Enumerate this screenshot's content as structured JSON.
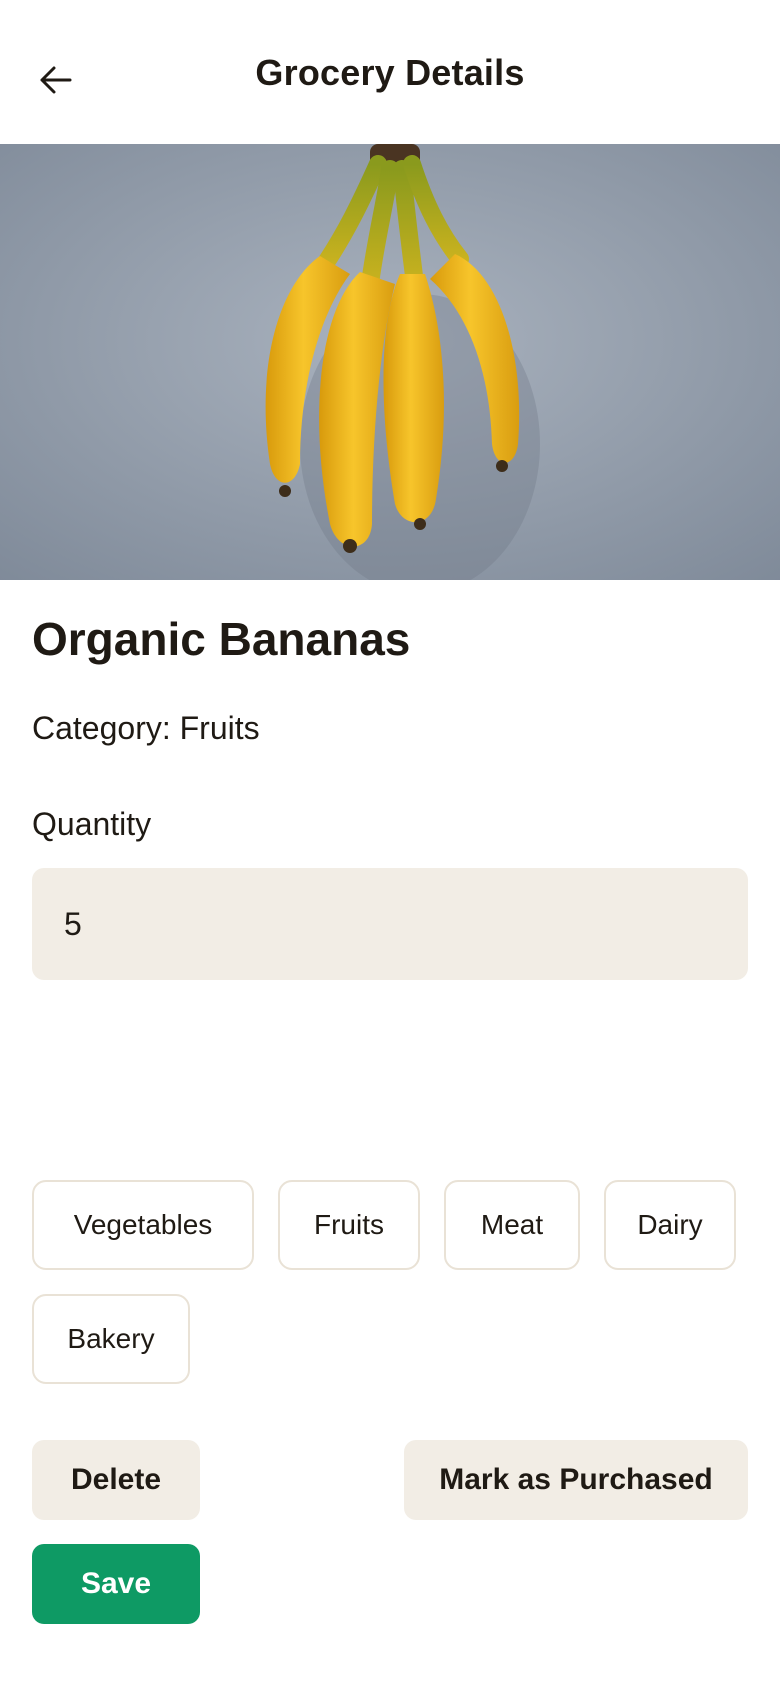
{
  "header": {
    "title": "Grocery Details",
    "back_icon": "arrow-left-icon"
  },
  "hero": {
    "image_description": "bunch of bananas on grey background",
    "background_color": "#8f9aa8",
    "banana_color": "#f0bb1c"
  },
  "item": {
    "name": "Organic Bananas",
    "category_text": "Category: Fruits"
  },
  "quantity": {
    "label": "Quantity",
    "value": "5"
  },
  "categories": [
    "Vegetables",
    "Fruits",
    "Meat",
    "Dairy",
    "Bakery"
  ],
  "actions": {
    "delete_label": "Delete",
    "mark_purchased_label": "Mark as Purchased",
    "save_label": "Save"
  },
  "colors": {
    "accent": "#0e9a64",
    "input_bg": "#f2ede5",
    "chip_border": "#e9e2d6",
    "text": "#1f1a14"
  }
}
